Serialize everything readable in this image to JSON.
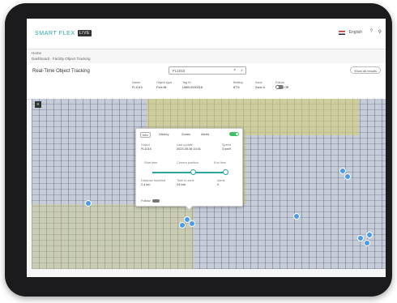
{
  "app": {
    "logo_text": "SMART FLEX",
    "logo_badge": "LIVE"
  },
  "topbar": {
    "language": "English",
    "help_icon": "help-icon",
    "user_icon": "user-icon"
  },
  "breadcrumb": {
    "line1": "Home",
    "line2": "Dashboard · Facility Object Tracking"
  },
  "page": {
    "title": "Real-Time Object Tracking"
  },
  "search": {
    "value": "FL1010",
    "clear": "×"
  },
  "show_all_button": "Show all results",
  "columns": [
    {
      "label": "Name",
      "value": "FL1010"
    },
    {
      "label": "Object type",
      "value": "Fork lift"
    },
    {
      "label": "Tag ID",
      "value": "UWB-0030018"
    },
    {
      "label": "Battery",
      "value": "87%"
    },
    {
      "label": "Zone",
      "value": "Zone A"
    },
    {
      "label": "Follow",
      "value": "Off"
    }
  ],
  "popup": {
    "tabs": [
      "Info",
      "History",
      "Zones",
      "Alerts"
    ],
    "fields": [
      {
        "label": "Object",
        "value": "FL1010"
      },
      {
        "label": "Last update",
        "value": "2023-05-06 10:41"
      },
      {
        "label": "Speed",
        "value": "3 km/h"
      },
      {
        "label": "Start time",
        "value": "10:00"
      },
      {
        "label": "Current position",
        "value": "10:35"
      },
      {
        "label": "End time",
        "value": "11:00"
      },
      {
        "label": "Distance travelled",
        "value": "2.4 km"
      },
      {
        "label": "Time in zone",
        "value": "24 min"
      },
      {
        "label": "Alerts",
        "value": "0"
      }
    ],
    "slider_fraction": 0.55,
    "bottom_label": "Follow"
  },
  "colors": {
    "accent": "#2aa7a0",
    "tag_dot": "#4c9be8",
    "zone": "#d2cd6e"
  }
}
